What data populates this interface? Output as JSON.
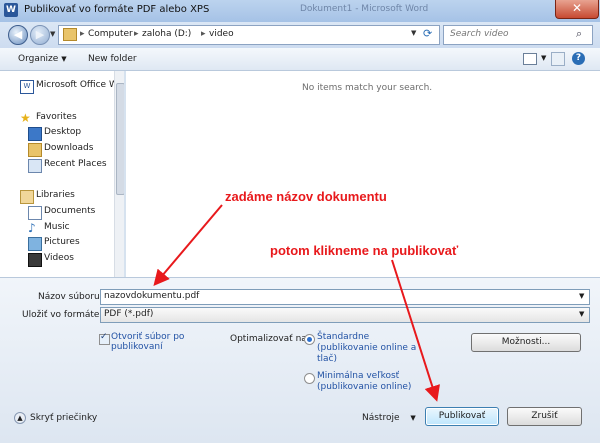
{
  "window": {
    "title": "Publikovať vo formáte PDF alebo XPS",
    "background_title": "Dokument1 - Microsoft Word",
    "app_icon_letter": "W"
  },
  "address": {
    "crumbs": [
      "Computer",
      "zaloha (D:)",
      "video"
    ],
    "search_placeholder": "Search video"
  },
  "toolbar": {
    "organize_label": "Organize",
    "new_folder_label": "New folder"
  },
  "nav": {
    "top_item": "Microsoft Office W",
    "favorites_label": "Favorites",
    "favorites": [
      "Desktop",
      "Downloads",
      "Recent Places"
    ],
    "libraries_label": "Libraries",
    "libraries": [
      "Documents",
      "Music",
      "Pictures",
      "Videos"
    ]
  },
  "filepane": {
    "empty_message": "No items match your search."
  },
  "form": {
    "filename_label": "Názov súboru:",
    "filename_value": "nazovdokumentu.pdf",
    "filetype_label": "Uložiť vo formáte:",
    "filetype_value": "PDF (*.pdf)",
    "open_after_label_1": "Otvoriť súbor po",
    "open_after_label_2": "publikovaní",
    "optimize_label": "Optimalizovať na:",
    "standard_label_1": "Štandardne",
    "standard_label_2": "(publikovanie online a",
    "standard_label_3": "tlač)",
    "minimal_label_1": "Minimálna veľkosť",
    "minimal_label_2": "(publikovanie online)",
    "options_button": "Možnosti...",
    "hide_folders_label": "Skryť priečinky",
    "tools_label": "Nástroje",
    "publish_button": "Publikovať",
    "cancel_button": "Zrušiť"
  },
  "annotations": {
    "note_name": "zadáme názov dokumentu",
    "note_publish": "potom klikneme na publikovať"
  },
  "colors": {
    "annotation": "#e8191c",
    "title_bar": "#bcd3ee"
  }
}
